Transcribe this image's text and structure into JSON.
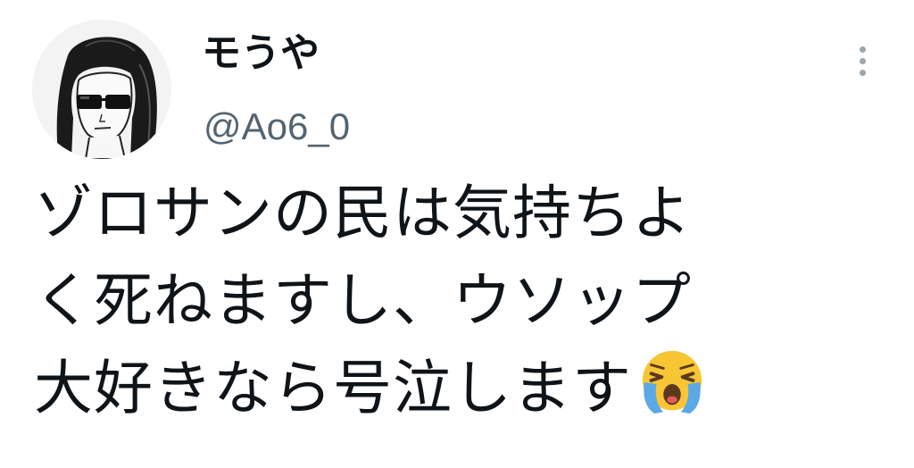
{
  "user": {
    "display_name": "モうや",
    "handle": "@Ao6_0",
    "avatar_icon": "avatar-sunglasses-portrait"
  },
  "menu": {
    "icon": "more-vertical-icon"
  },
  "tweet": {
    "lines": [
      "ゾロサンの民は気持ちよ",
      "く死ねますし、ウソップ",
      "大好きなら号泣します"
    ],
    "trailing_emoji": "loudly-crying-face-icon"
  },
  "colors": {
    "text": "#0f1419",
    "secondary_text": "#536471",
    "emoji_face": "#f8c634",
    "emoji_tears": "#5aa9e6"
  }
}
